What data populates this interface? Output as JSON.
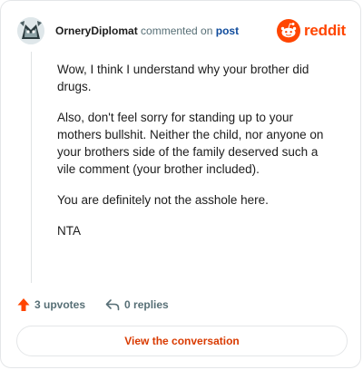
{
  "header": {
    "username": "OrneryDiplomat",
    "action_text": "commented on",
    "post_link": "post",
    "brand_name": "reddit"
  },
  "comment": {
    "paragraphs": [
      "Wow, I think I understand why your brother did drugs.",
      "Also, don't feel sorry for standing up to your mothers bullshit. Neither the child, nor anyone on your brothers side of the family deserved such a vile comment (your brother included).",
      "You are definitely not the asshole here.",
      "NTA"
    ]
  },
  "footer": {
    "upvotes": "3 upvotes",
    "replies": "0 replies"
  },
  "cta": {
    "label": "View the conversation"
  },
  "colors": {
    "brand": "#ff4500",
    "link": "#0f4b9c",
    "cta_text": "#d93a00",
    "muted": "#576f76"
  },
  "icons": {
    "avatar": "user-avatar",
    "brand": "reddit-logo-icon",
    "upvote": "upvote-arrow-icon",
    "reply": "reply-arrow-icon"
  }
}
